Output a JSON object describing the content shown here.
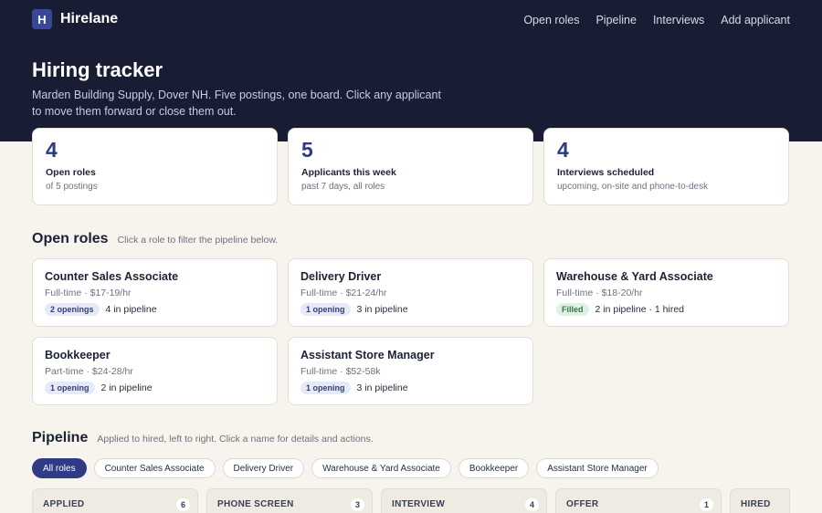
{
  "app": {
    "logo_letter": "H",
    "name": "Hirelane"
  },
  "nav": [
    "Open roles",
    "Pipeline",
    "Interviews",
    "Add applicant"
  ],
  "hero": {
    "title": "Hiring tracker",
    "subtitle": "Marden Building Supply, Dover NH. Five postings, one board. Click any applicant to move them forward or close them out."
  },
  "stats": [
    {
      "value": "4",
      "label": "Open roles",
      "sub": "of 5 postings"
    },
    {
      "value": "5",
      "label": "Applicants this week",
      "sub": "past 7 days, all roles"
    },
    {
      "value": "4",
      "label": "Interviews scheduled",
      "sub": "upcoming, on-site and phone-to-desk"
    }
  ],
  "open_roles": {
    "heading": "Open roles",
    "hint": "Click a role to filter the pipeline below.",
    "roles": [
      {
        "title": "Counter Sales Associate",
        "meta": "Full-time · $17-19/hr",
        "badge": "2 openings",
        "badge_type": "openings",
        "status": "4 in pipeline"
      },
      {
        "title": "Delivery Driver",
        "meta": "Full-time · $21-24/hr",
        "badge": "1 opening",
        "badge_type": "openings",
        "status": "3 in pipeline"
      },
      {
        "title": "Warehouse & Yard Associate",
        "meta": "Full-time · $18-20/hr",
        "badge": "Filled",
        "badge_type": "filled",
        "status": "2 in pipeline · 1 hired"
      },
      {
        "title": "Bookkeeper",
        "meta": "Part-time · $24-28/hr",
        "badge": "1 opening",
        "badge_type": "openings",
        "status": "2 in pipeline"
      },
      {
        "title": "Assistant Store Manager",
        "meta": "Full-time · $52-58k",
        "badge": "1 opening",
        "badge_type": "openings",
        "status": "3 in pipeline"
      }
    ]
  },
  "pipeline": {
    "heading": "Pipeline",
    "hint": "Applied to hired, left to right. Click a name for details and actions.",
    "filters": [
      "All roles",
      "Counter Sales Associate",
      "Delivery Driver",
      "Warehouse & Yard Associate",
      "Bookkeeper",
      "Assistant Store Manager"
    ],
    "active_filter": "All roles",
    "columns": [
      {
        "title": "APPLIED",
        "count": "6"
      },
      {
        "title": "PHONE SCREEN",
        "count": "3"
      },
      {
        "title": "INTERVIEW",
        "count": "4"
      },
      {
        "title": "OFFER",
        "count": "1"
      },
      {
        "title": "HIRED",
        "count": ""
      }
    ]
  },
  "colors": {
    "hero_bg": "#181d33",
    "accent": "#2f3b86",
    "page_bg": "#f7f4ee",
    "filled_badge": "#2d7a44"
  }
}
